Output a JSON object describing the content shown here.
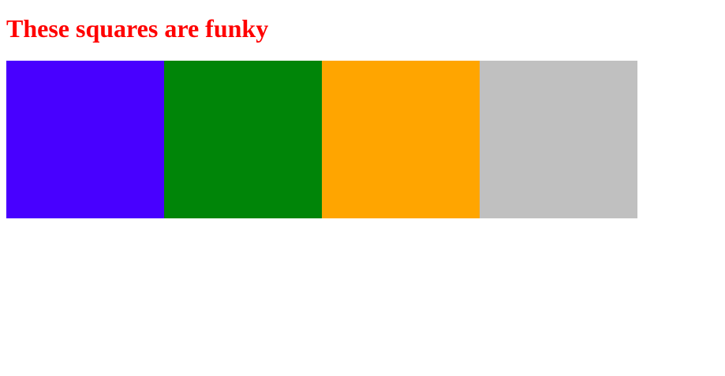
{
  "heading": {
    "text": "These squares are funky",
    "color": "#ff0000"
  },
  "squares": [
    {
      "name": "square-purple",
      "color": "#4800ff"
    },
    {
      "name": "square-green",
      "color": "#008508"
    },
    {
      "name": "square-orange",
      "color": "#ffa500"
    },
    {
      "name": "square-silver",
      "color": "#c0c0c0"
    }
  ]
}
